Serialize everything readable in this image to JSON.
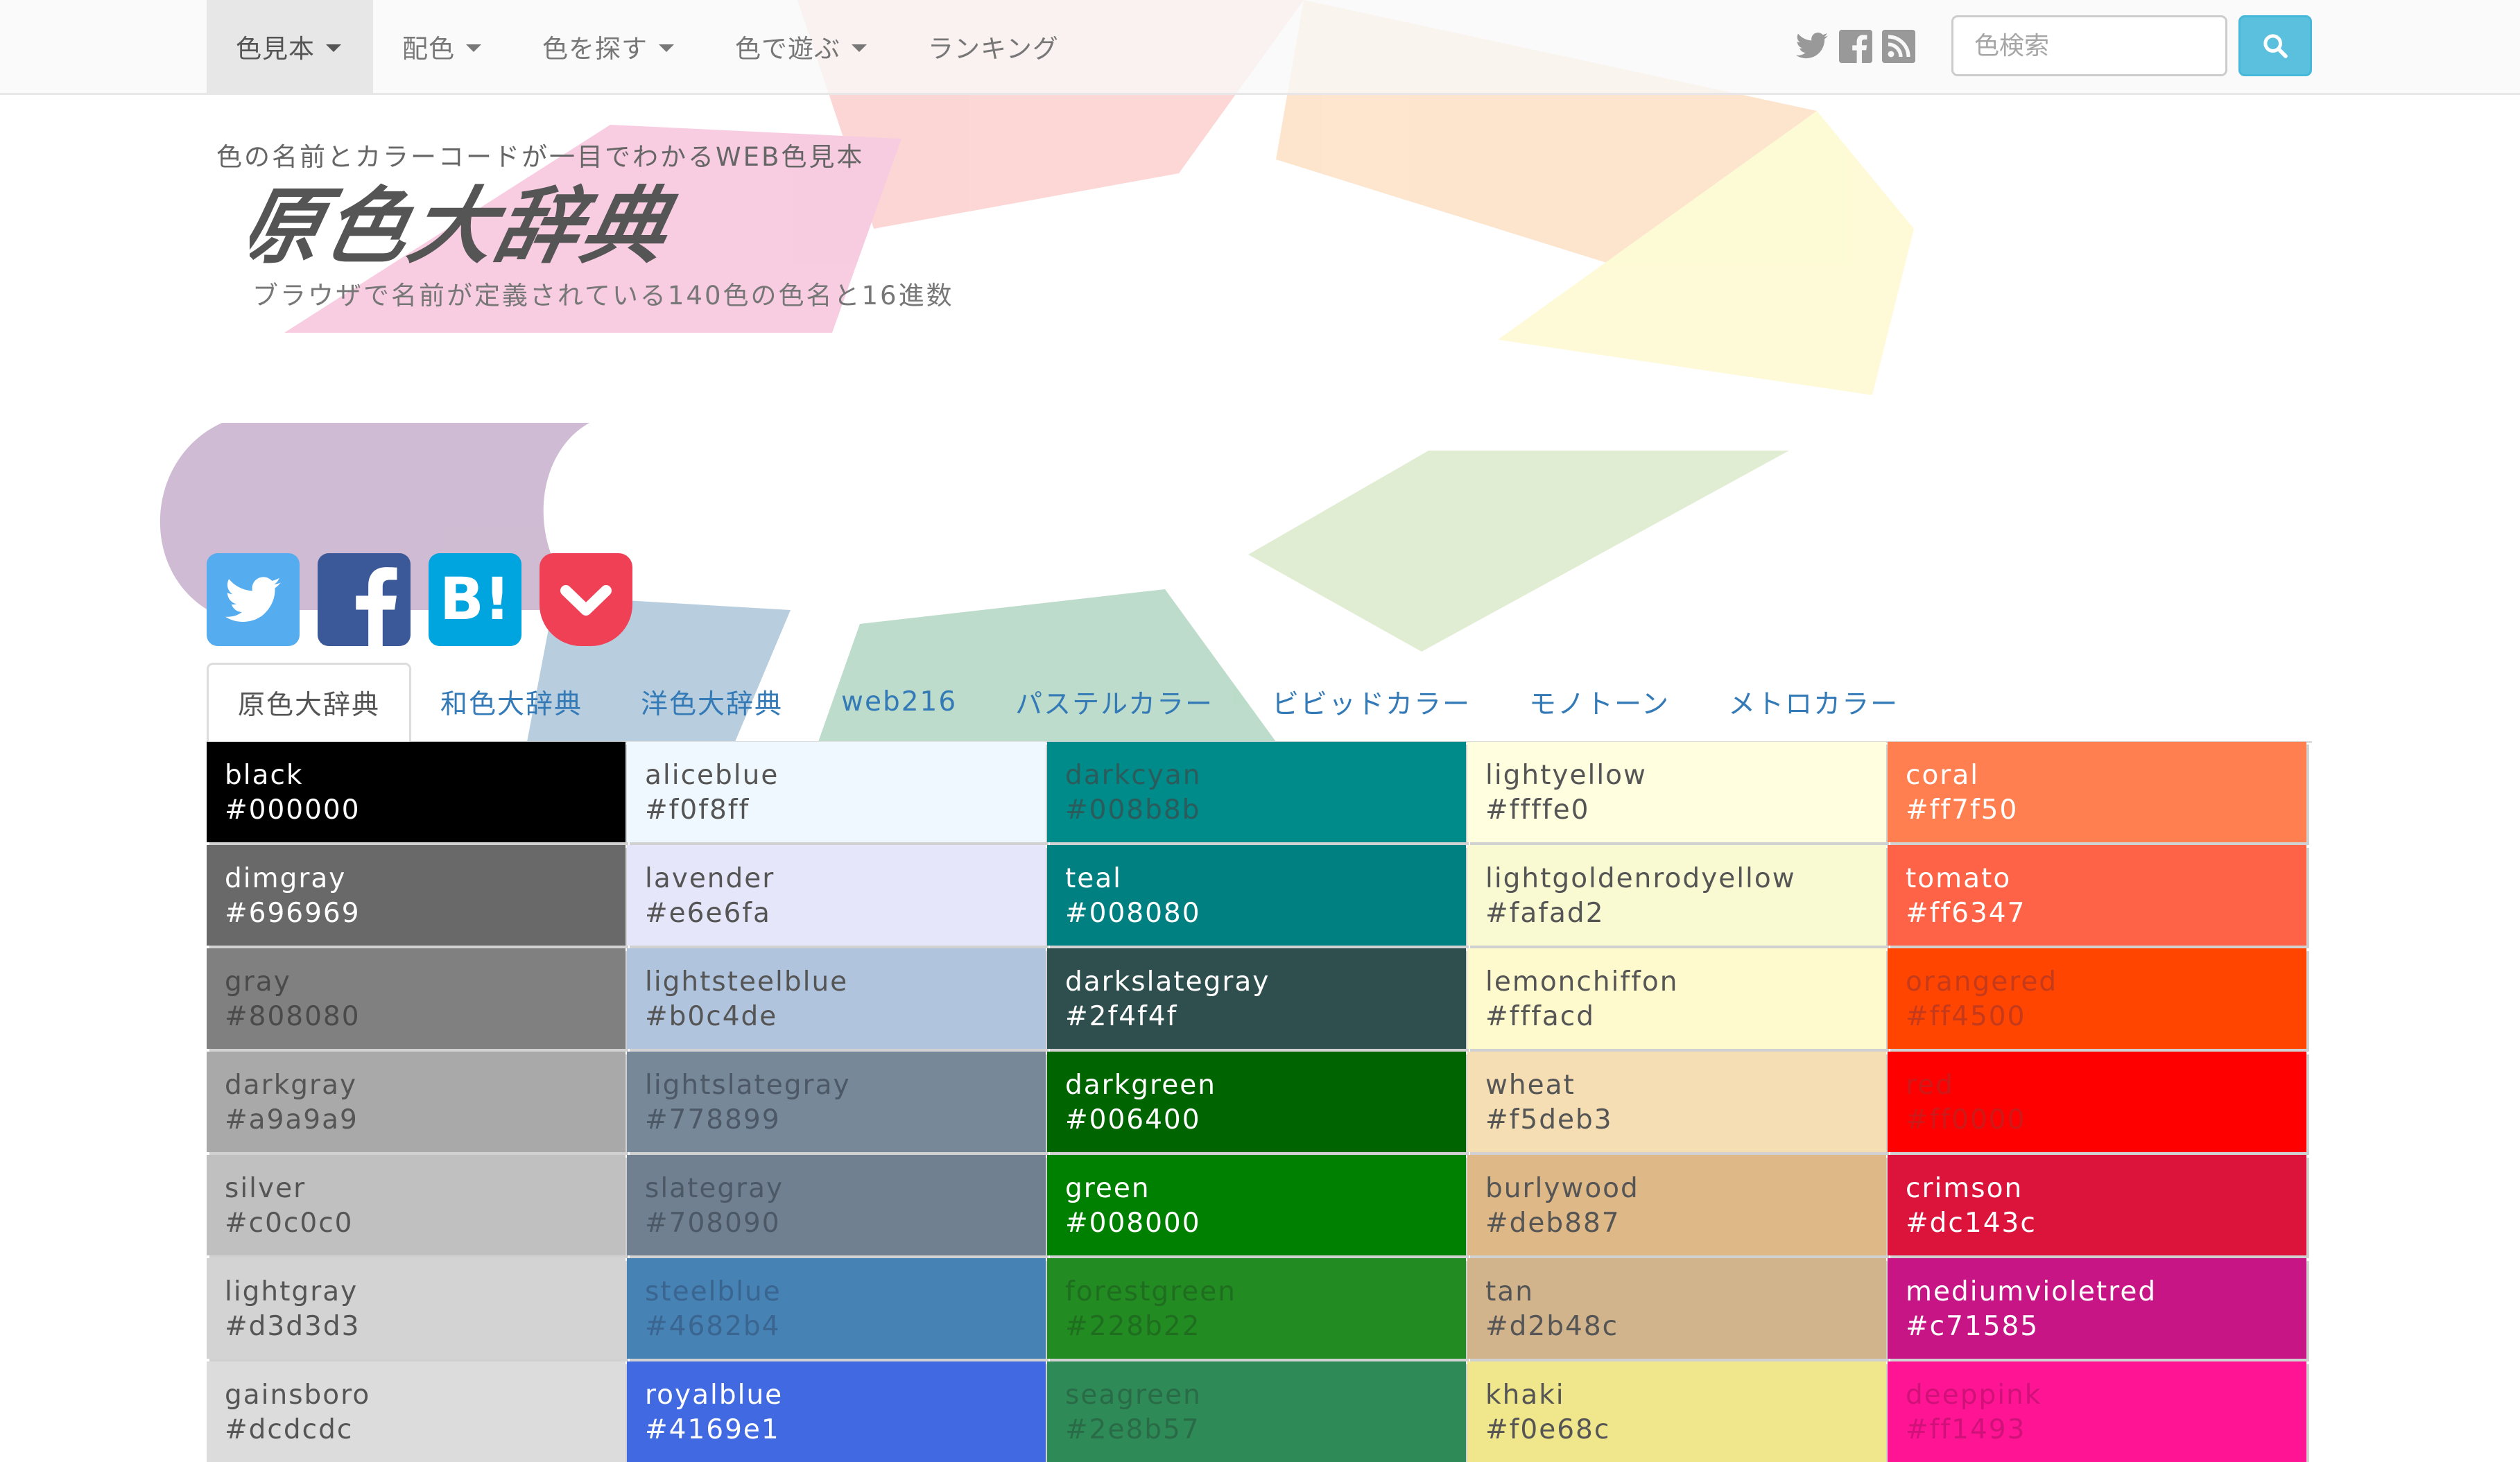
{
  "navbar": {
    "items": [
      {
        "label": "色見本",
        "dropdown": true,
        "active": true
      },
      {
        "label": "配色",
        "dropdown": true,
        "active": false
      },
      {
        "label": "色を探す",
        "dropdown": true,
        "active": false
      },
      {
        "label": "色で遊ぶ",
        "dropdown": true,
        "active": false
      },
      {
        "label": "ランキング",
        "dropdown": false,
        "active": false
      }
    ],
    "social_icons": [
      "twitter-icon",
      "facebook-icon",
      "rss-icon"
    ],
    "search": {
      "placeholder": "色検索",
      "value": "",
      "button_icon": "search-icon"
    }
  },
  "header": {
    "tagline": "色の名前とカラーコードが一目でわかるWEB色見本",
    "logo_text": "原色大辞典",
    "subtitle": "ブラウザで名前が定義されている140色の色名と16進数"
  },
  "share_buttons": [
    {
      "icon": "twitter-icon",
      "color": "#55acee"
    },
    {
      "icon": "facebook-icon",
      "color": "#3b5998"
    },
    {
      "icon": "hatena-bookmark-icon",
      "label": "B!",
      "color": "#00a4de"
    },
    {
      "icon": "pocket-icon",
      "color": "#ef4056"
    }
  ],
  "tabs": [
    {
      "label": "原色大辞典",
      "active": true
    },
    {
      "label": "和色大辞典",
      "active": false
    },
    {
      "label": "洋色大辞典",
      "active": false
    },
    {
      "label": "web216",
      "active": false
    },
    {
      "label": "パステルカラー",
      "active": false
    },
    {
      "label": "ビビッドカラー",
      "active": false
    },
    {
      "label": "モノトーン",
      "active": false
    },
    {
      "label": "メトロカラー",
      "active": false
    }
  ],
  "colors": [
    {
      "name": "black",
      "hex": "#000000",
      "text": "#ffffff"
    },
    {
      "name": "aliceblue",
      "hex": "#f0f8ff",
      "text": "#555555"
    },
    {
      "name": "darkcyan",
      "hex": "#008b8b",
      "text": "#2b5b5b"
    },
    {
      "name": "lightyellow",
      "hex": "#ffffe0",
      "text": "#555555"
    },
    {
      "name": "coral",
      "hex": "#ff7f50",
      "text": "#ffffff"
    },
    {
      "name": "dimgray",
      "hex": "#696969",
      "text": "#ffffff"
    },
    {
      "name": "lavender",
      "hex": "#e6e6fa",
      "text": "#555555"
    },
    {
      "name": "teal",
      "hex": "#008080",
      "text": "#ffffff"
    },
    {
      "name": "lightgoldenrodyellow",
      "hex": "#fafad2",
      "text": "#555555"
    },
    {
      "name": "tomato",
      "hex": "#ff6347",
      "text": "#ffffff"
    },
    {
      "name": "gray",
      "hex": "#808080",
      "text": "#4a4a4a"
    },
    {
      "name": "lightsteelblue",
      "hex": "#b0c4de",
      "text": "#555555"
    },
    {
      "name": "darkslategray",
      "hex": "#2f4f4f",
      "text": "#ffffff"
    },
    {
      "name": "lemonchiffon",
      "hex": "#fffacd",
      "text": "#555555"
    },
    {
      "name": "orangered",
      "hex": "#ff4500",
      "text": "#c43a1a"
    },
    {
      "name": "darkgray",
      "hex": "#a9a9a9",
      "text": "#555555"
    },
    {
      "name": "lightslategray",
      "hex": "#778899",
      "text": "#4c5866"
    },
    {
      "name": "darkgreen",
      "hex": "#006400",
      "text": "#ffffff"
    },
    {
      "name": "wheat",
      "hex": "#f5deb3",
      "text": "#555555"
    },
    {
      "name": "red",
      "hex": "#ff0000",
      "text": "#cc1a1a"
    },
    {
      "name": "silver",
      "hex": "#c0c0c0",
      "text": "#555555"
    },
    {
      "name": "slategray",
      "hex": "#708090",
      "text": "#4c5866"
    },
    {
      "name": "green",
      "hex": "#008000",
      "text": "#ffffff"
    },
    {
      "name": "burlywood",
      "hex": "#deb887",
      "text": "#555555"
    },
    {
      "name": "crimson",
      "hex": "#dc143c",
      "text": "#ffffff"
    },
    {
      "name": "lightgray",
      "hex": "#d3d3d3",
      "text": "#555555"
    },
    {
      "name": "steelblue",
      "hex": "#4682b4",
      "text": "#3a6590"
    },
    {
      "name": "forestgreen",
      "hex": "#228b22",
      "text": "#1f6e1f"
    },
    {
      "name": "tan",
      "hex": "#d2b48c",
      "text": "#555555"
    },
    {
      "name": "mediumvioletred",
      "hex": "#c71585",
      "text": "#ffffff"
    },
    {
      "name": "gainsboro",
      "hex": "#dcdcdc",
      "text": "#555555"
    },
    {
      "name": "royalblue",
      "hex": "#4169e1",
      "text": "#ffffff"
    },
    {
      "name": "seagreen",
      "hex": "#2e8b57",
      "text": "#2a6b47"
    },
    {
      "name": "khaki",
      "hex": "#f0e68c",
      "text": "#555555"
    },
    {
      "name": "deeppink",
      "hex": "#ff1493",
      "text": "#d0117a"
    }
  ]
}
